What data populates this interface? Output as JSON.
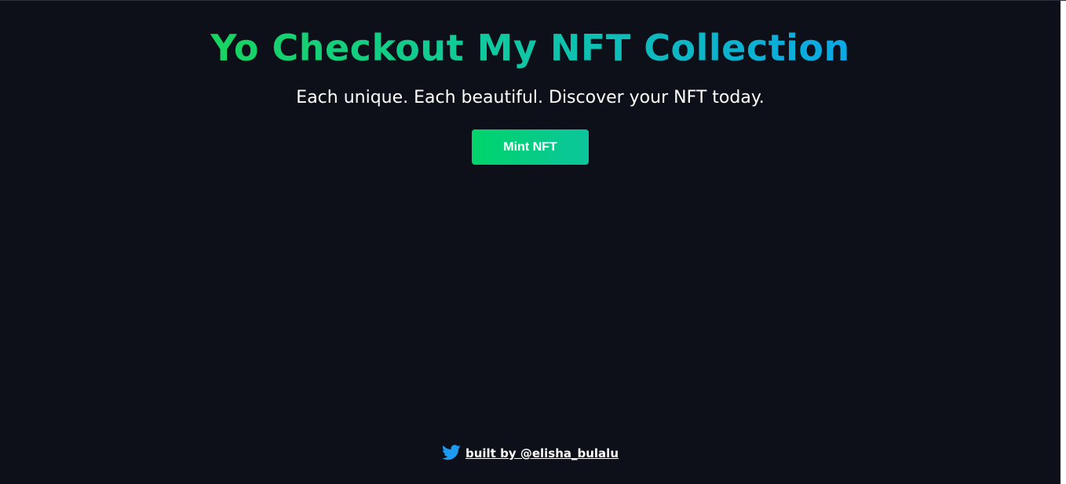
{
  "header": {
    "title": "Yo Checkout My NFT Collection",
    "subtitle": "Each unique. Each beautiful. Discover your NFT today."
  },
  "actions": {
    "mint_label": "Mint NFT"
  },
  "footer": {
    "icon": "twitter-icon",
    "link_text": "built by @elisha_bulalu"
  },
  "colors": {
    "background": "#0d1018",
    "title_gradient_start": "#18d45f",
    "title_gradient_end": "#0aa8e6",
    "button_gradient_start": "#00d46a",
    "button_gradient_end": "#0bc59c",
    "twitter_blue": "#1d9bf0"
  }
}
